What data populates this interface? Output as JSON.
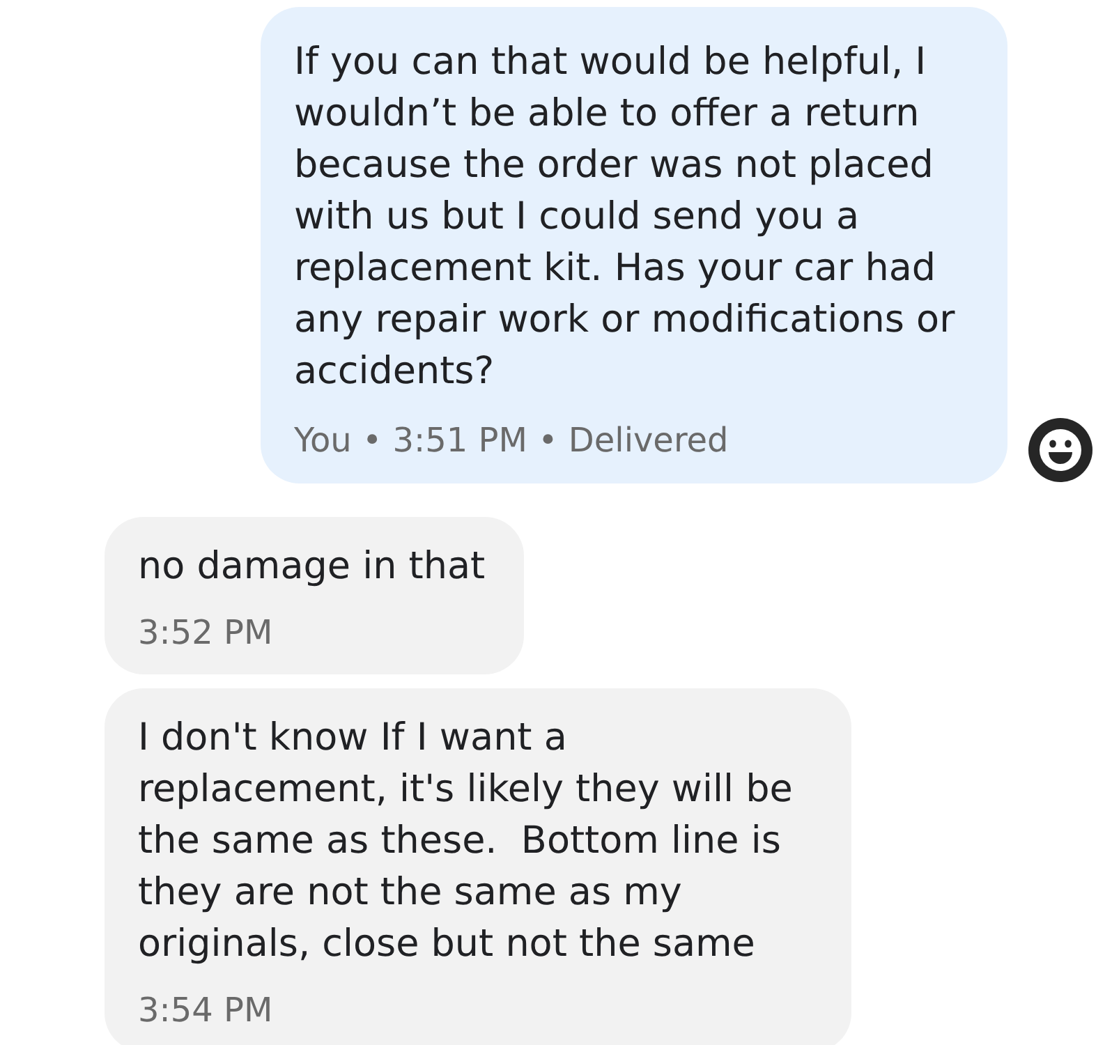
{
  "messages": [
    {
      "kind": "outgoing",
      "text": "If you can that would be helpful, I wouldn’t be able to offer a return because the order was not placed with us but I could send you a replacement kit. Has your car had any repair work or modifications or accidents?",
      "footer": "You • 3:51 PM • Delivered",
      "reaction_button": true
    },
    {
      "kind": "incoming",
      "text": "no damage in that",
      "footer": "3:52 PM",
      "reaction_button": false
    },
    {
      "kind": "incoming",
      "text": "I don't know If I want a replacement, it's likely they will be the same as these.  Bottom line is they are not the same as my originals, close but not the same",
      "footer": "3:54 PM",
      "reaction_button": false
    }
  ]
}
